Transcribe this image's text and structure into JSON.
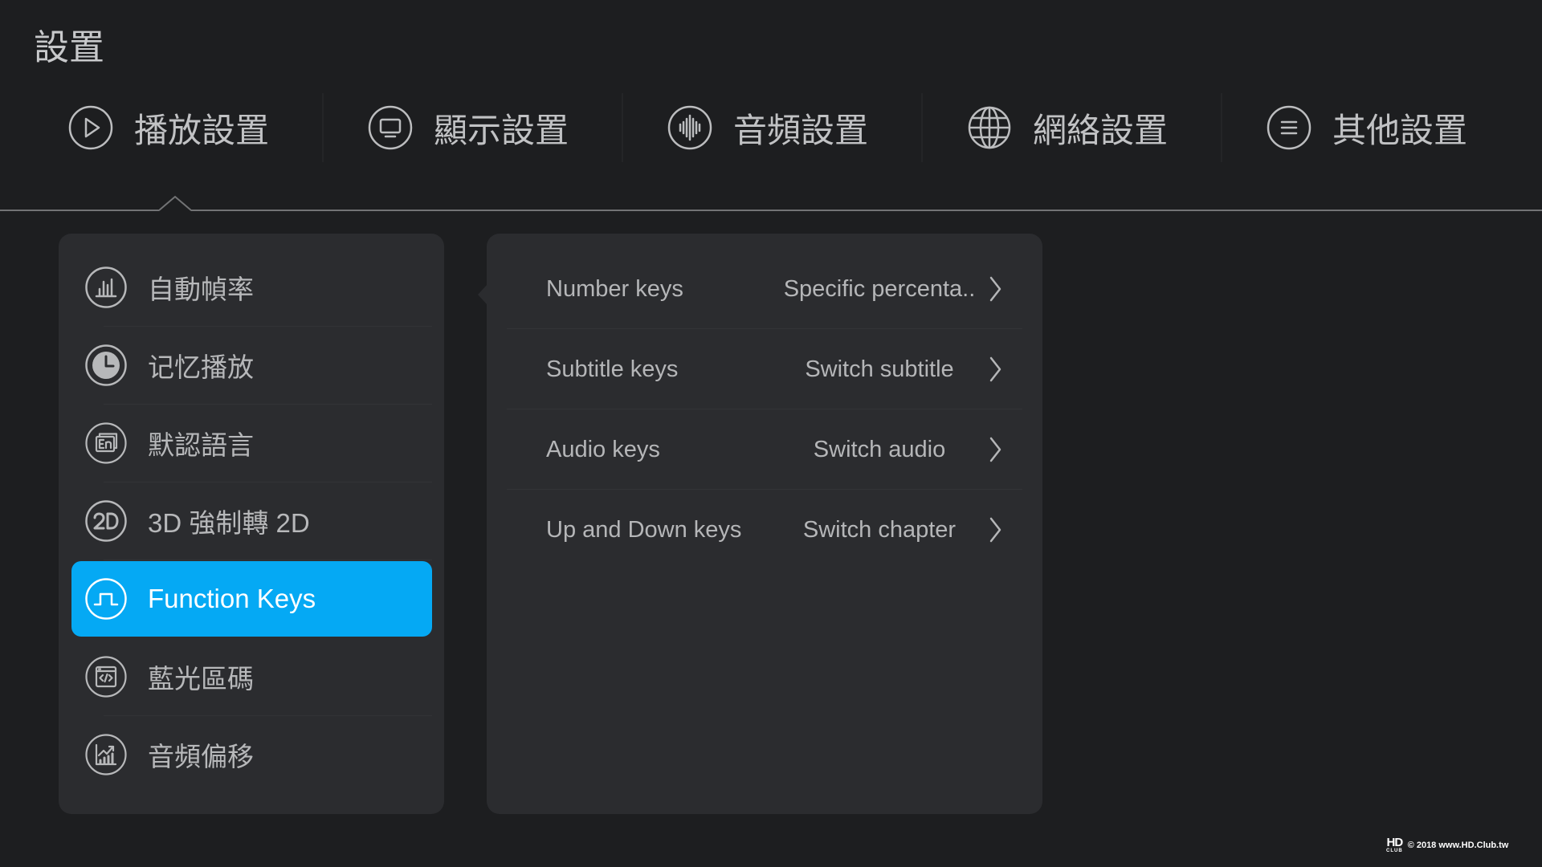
{
  "page_title": "設置",
  "tabs": [
    {
      "label": "播放設置",
      "icon": "play-icon",
      "active": true
    },
    {
      "label": "顯示設置",
      "icon": "monitor-icon"
    },
    {
      "label": "音頻設置",
      "icon": "audio-waveform-icon"
    },
    {
      "label": "網絡設置",
      "icon": "globe-icon"
    },
    {
      "label": "其他設置",
      "icon": "menu-lines-icon"
    }
  ],
  "menu": {
    "items": [
      {
        "label": "自動幀率",
        "icon": "bar-chart-icon"
      },
      {
        "label": "记忆播放",
        "icon": "clock-icon"
      },
      {
        "label": "默認語言",
        "icon": "language-icon"
      },
      {
        "label": "3D 強制轉 2D",
        "icon": "2d-icon"
      },
      {
        "label": "Function Keys",
        "icon": "square-wave-icon",
        "selected": true
      },
      {
        "label": "藍光區碼",
        "icon": "code-window-icon"
      },
      {
        "label": "音頻偏移",
        "icon": "chart-trend-icon"
      }
    ]
  },
  "function_keys": {
    "rows": [
      {
        "label": "Number keys",
        "value": "Specific percenta.."
      },
      {
        "label": "Subtitle keys",
        "value": "Switch subtitle"
      },
      {
        "label": "Audio keys",
        "value": "Switch audio"
      },
      {
        "label": "Up and Down keys",
        "value": "Switch chapter"
      }
    ]
  },
  "watermark": {
    "logo_top": "HD",
    "logo_bottom": "CLUB",
    "text": "© 2018 www.HD.Club.tw"
  },
  "colors": {
    "background": "#1d1e20",
    "panel": "#2b2c2f",
    "accent": "#05a9f4",
    "text": "#b7b8ba",
    "line": "#727375"
  }
}
